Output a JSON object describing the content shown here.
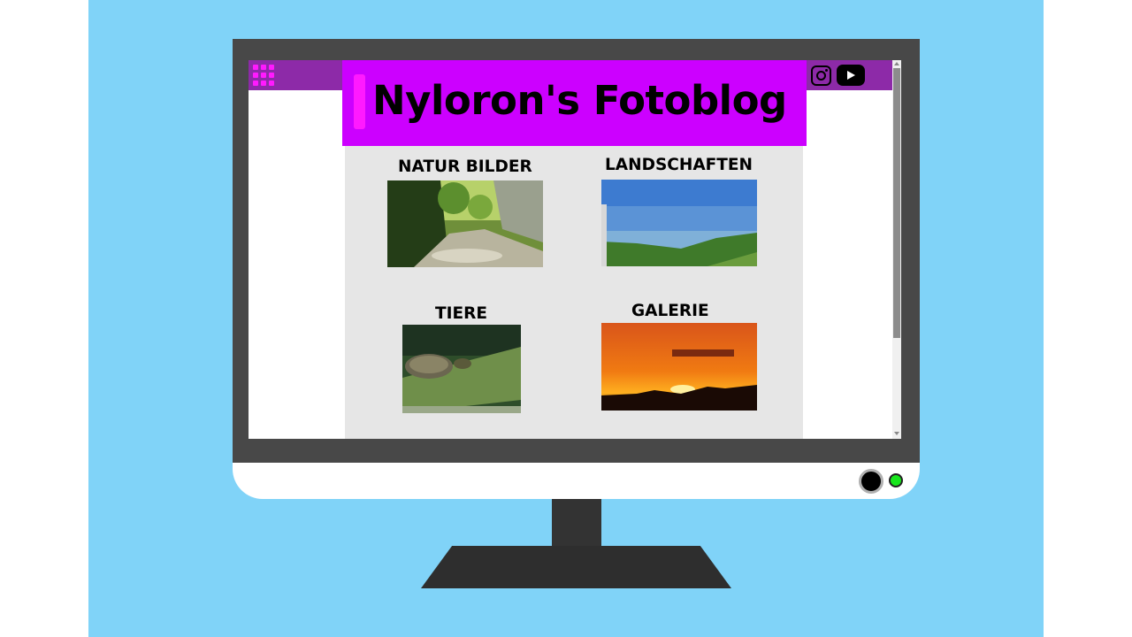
{
  "site": {
    "title": "Nyloron's Fotoblog"
  },
  "topbar": {
    "icons": [
      "apps-grid-icon",
      "instagram-icon",
      "youtube-icon"
    ]
  },
  "sections": [
    {
      "title": "NATUR BILDER",
      "image": "forest-gorge-photo"
    },
    {
      "title": "LANDSCHAFTEN",
      "image": "lake-panorama-photo"
    },
    {
      "title": "TIERE",
      "image": "turtle-photo"
    },
    {
      "title": "GALERIE",
      "image": "sunset-photo"
    }
  ],
  "colors": {
    "background": "#80d3f8",
    "header": "#cc00ff",
    "header_accent": "#ff1aff",
    "topbar": "#8d2aa8",
    "content": "#e6e6e6",
    "monitor_frame": "#484848",
    "power_led": "#19e61d"
  }
}
